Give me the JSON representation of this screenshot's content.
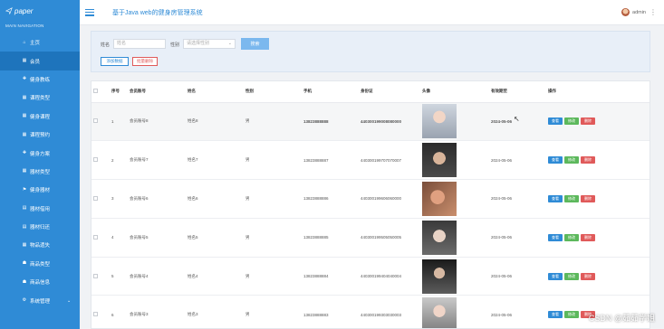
{
  "sidebar": {
    "logo": "paper",
    "caption": "MAIN NAVIGATION",
    "items": [
      {
        "icon": "home-icon",
        "glyph": "⌂",
        "label": "主页"
      },
      {
        "icon": "grid-icon",
        "glyph": "▦",
        "label": "会员"
      },
      {
        "icon": "dumbbell-icon",
        "glyph": "✚",
        "label": "健身教练"
      },
      {
        "icon": "grid-icon",
        "glyph": "▦",
        "label": "课程类型"
      },
      {
        "icon": "grid-icon",
        "glyph": "▦",
        "label": "健身课程"
      },
      {
        "icon": "grid-icon",
        "glyph": "▦",
        "label": "课程预约"
      },
      {
        "icon": "dumbbell-icon",
        "glyph": "✚",
        "label": "健身方案"
      },
      {
        "icon": "grid-icon",
        "glyph": "▦",
        "label": "器材类型"
      },
      {
        "icon": "flag-icon",
        "glyph": "⚑",
        "label": "健身器材"
      },
      {
        "icon": "building-icon",
        "glyph": "▤",
        "label": "器材借用"
      },
      {
        "icon": "building-icon",
        "glyph": "▤",
        "label": "器材归还"
      },
      {
        "icon": "grid-icon",
        "glyph": "▦",
        "label": "物品遗失"
      },
      {
        "icon": "shop-icon",
        "glyph": "☗",
        "label": "商品类型"
      },
      {
        "icon": "shop-icon",
        "glyph": "☗",
        "label": "商品信息"
      },
      {
        "icon": "gear-icon",
        "glyph": "⚙",
        "label": "系统管理"
      }
    ]
  },
  "header": {
    "title": "基于Java web的健身房管理系统",
    "user": "admin"
  },
  "search": {
    "name_label": "姓名",
    "name_placeholder": "姓名",
    "gender_label": "性别",
    "gender_placeholder": "请选择性别",
    "search_button": "搜索",
    "add_button": "添加数据",
    "batch_delete_button": "批量删除"
  },
  "table": {
    "columns": [
      "序号",
      "会员账号",
      "姓名",
      "性别",
      "手机",
      "身份证",
      "头像",
      "有效期至",
      "操作"
    ],
    "actions": [
      "查看",
      "修改",
      "删除"
    ],
    "rows": [
      {
        "no": "1",
        "account": "会员账号8",
        "name": "姓名8",
        "gender": "男",
        "phone": "13823888888",
        "id_card": "440300199008080000",
        "photo": "a",
        "expire": "2024-05-06"
      },
      {
        "no": "2",
        "account": "会员账号7",
        "name": "姓名7",
        "gender": "男",
        "phone": "13823888887",
        "id_card": "440300199707070007",
        "photo": "b",
        "expire": "2024-05-06"
      },
      {
        "no": "3",
        "account": "会员账号6",
        "name": "姓名6",
        "gender": "男",
        "phone": "13823888886",
        "id_card": "440300199606060000",
        "photo": "c",
        "expire": "2024-05-06"
      },
      {
        "no": "4",
        "account": "会员账号5",
        "name": "姓名5",
        "gender": "男",
        "phone": "13823888885",
        "id_card": "440300199505050005",
        "photo": "d",
        "expire": "2024-05-06"
      },
      {
        "no": "5",
        "account": "会员账号4",
        "name": "姓名4",
        "gender": "男",
        "phone": "13823888884",
        "id_card": "440300199404040004",
        "photo": "e",
        "expire": "2024-05-06"
      },
      {
        "no": "6",
        "account": "会员账号3",
        "name": "姓名3",
        "gender": "男",
        "phone": "13823888883",
        "id_card": "440300199303030003",
        "photo": "f",
        "expire": "2024-05-06"
      }
    ]
  },
  "watermark": "CSDN @茹茹学姐"
}
